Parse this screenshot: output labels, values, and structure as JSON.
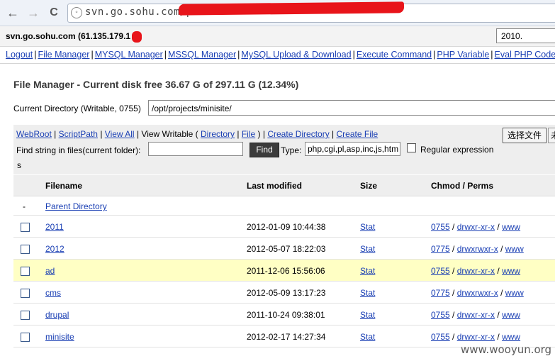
{
  "browser": {
    "back_glyph": "←",
    "forward_glyph": "→",
    "reload_glyph": "C",
    "url": "svn.go.sohu.com/p"
  },
  "shell": {
    "host": "svn.go.sohu.com (61.135.179.1",
    "select_value": "2010."
  },
  "menu": {
    "items": [
      "Logout",
      "File Manager",
      "MYSQL Manager",
      "MSSQL Manager",
      "MySQL Upload & Download",
      "Execute Command",
      "PHP Variable",
      "Eval PHP Code"
    ],
    "separator": "|"
  },
  "file_manager": {
    "title": "File Manager - Current disk free 36.67 G of 297.11 G (12.34%)",
    "current_dir_label": "Current Directory (Writable, 0755)",
    "current_dir_value": "/opt/projects/minisite/"
  },
  "tools": {
    "webroot": "WebRoot",
    "scriptpath": "ScriptPath",
    "view_all": "View All",
    "view_writable": "View Writable (",
    "directory": "Directory",
    "file": "File",
    "close_paren": ")",
    "create_directory": "Create Directory",
    "create_file": "Create File",
    "upload_button": "选择文件",
    "upload_button2": "未",
    "find_label": "Find string in files(current folder):",
    "find_button": "Find",
    "type_label": "Type:",
    "type_value": "php,cgi,pl,asp,inc,js,htm",
    "regex_label": "Regular expression",
    "wrap_s": "s"
  },
  "table": {
    "headers": {
      "filename": "Filename",
      "last_modified": "Last modified",
      "size": "Size",
      "chmod": "Chmod / Perms"
    },
    "parent": {
      "dash": "-",
      "label": "Parent Directory"
    },
    "rows": [
      {
        "name": "2011",
        "modified": "2012-01-09 10:44:38",
        "size": "Stat",
        "chmod": "0755",
        "perms": "drwxr-xr-x",
        "owner": "www"
      },
      {
        "name": "2012",
        "modified": "2012-05-07 18:22:03",
        "size": "Stat",
        "chmod": "0775",
        "perms": "drwxrwxr-x",
        "owner": "www"
      },
      {
        "name": "ad",
        "modified": "2011-12-06 15:56:06",
        "size": "Stat",
        "chmod": "0755",
        "perms": "drwxr-xr-x",
        "owner": "www"
      },
      {
        "name": "cms",
        "modified": "2012-05-09 13:17:23",
        "size": "Stat",
        "chmod": "0775",
        "perms": "drwxrwxr-x",
        "owner": "www"
      },
      {
        "name": "drupal",
        "modified": "2011-10-24 09:38:01",
        "size": "Stat",
        "chmod": "0755",
        "perms": "drwxr-xr-x",
        "owner": "www"
      },
      {
        "name": "minisite",
        "modified": "2012-02-17 14:27:34",
        "size": "Stat",
        "chmod": "0755",
        "perms": "drwxr-xr-x",
        "owner": "www"
      }
    ],
    "slash": "/"
  },
  "watermark": "www.wooyun.org"
}
